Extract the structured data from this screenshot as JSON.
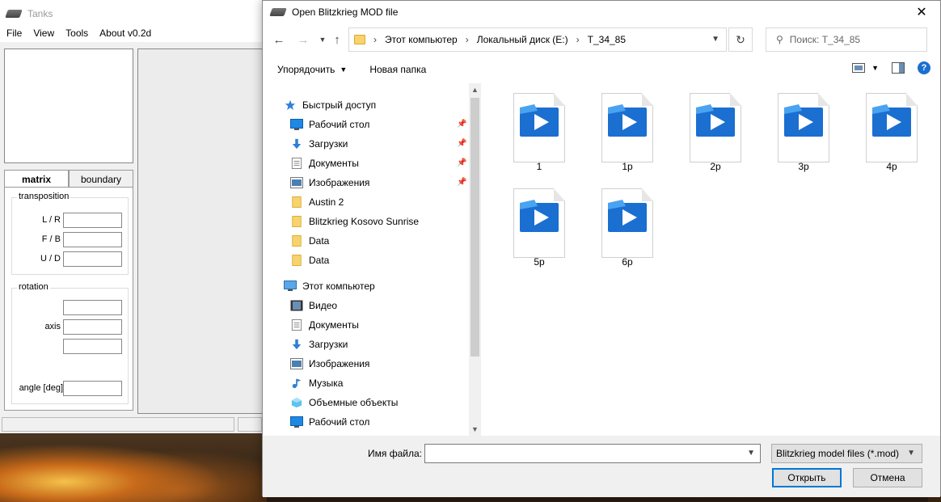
{
  "tanks_app": {
    "title": "Tanks",
    "menu": [
      "File",
      "View",
      "Tools",
      "About v0.2d"
    ],
    "tabs": [
      "matrix",
      "boundary"
    ],
    "transposition": {
      "title": "transposition",
      "labels": [
        "L / R",
        "F / B",
        "U / D"
      ]
    },
    "rotation": {
      "title": "rotation",
      "axis_label": "axis",
      "angle_label": "angle [deg]"
    }
  },
  "dialog": {
    "title": "Open Blitzkrieg MOD file",
    "close_glyph": "✕",
    "breadcrumb": [
      "Этот компьютер",
      "Локальный диск (E:)",
      "T_34_85"
    ],
    "search_placeholder": "Поиск: T_34_85",
    "toolbar": {
      "organize": "Упорядочить",
      "new_folder": "Новая папка"
    },
    "nav": {
      "quick_access": "Быстрый доступ",
      "quick_items": [
        {
          "label": "Рабочий стол",
          "icon": "desktop-icon",
          "pinned": true
        },
        {
          "label": "Загрузки",
          "icon": "downloads-icon",
          "pinned": true
        },
        {
          "label": "Документы",
          "icon": "documents-icon",
          "pinned": true
        },
        {
          "label": "Изображения",
          "icon": "pictures-icon",
          "pinned": true
        },
        {
          "label": "Austin 2",
          "icon": "folder-icon",
          "pinned": false
        },
        {
          "label": "Blitzkrieg Kosovo Sunrise",
          "icon": "folder-icon",
          "pinned": false
        },
        {
          "label": "Data",
          "icon": "folder-icon",
          "pinned": false
        },
        {
          "label": "Data",
          "icon": "folder-icon",
          "pinned": false
        }
      ],
      "this_pc": "Этот компьютер",
      "pc_items": [
        {
          "label": "Видео",
          "icon": "video-icon"
        },
        {
          "label": "Документы",
          "icon": "documents-icon"
        },
        {
          "label": "Загрузки",
          "icon": "downloads-icon"
        },
        {
          "label": "Изображения",
          "icon": "pictures-icon"
        },
        {
          "label": "Музыка",
          "icon": "music-icon"
        },
        {
          "label": "Объемные объекты",
          "icon": "3d-objects-icon"
        },
        {
          "label": "Рабочий стол",
          "icon": "desktop-icon"
        }
      ]
    },
    "files": [
      "1",
      "1p",
      "2p",
      "3p",
      "4p",
      "5p",
      "6p"
    ],
    "filename_label": "Имя файла:",
    "filename_value": "",
    "filter": "Blitzkrieg model files (*.mod)",
    "open_button": "Открыть",
    "cancel_button": "Отмена",
    "colors": {
      "accent": "#0078d7",
      "media_blue": "#1a6fd1",
      "folder_yellow": "#f7d36b"
    }
  }
}
